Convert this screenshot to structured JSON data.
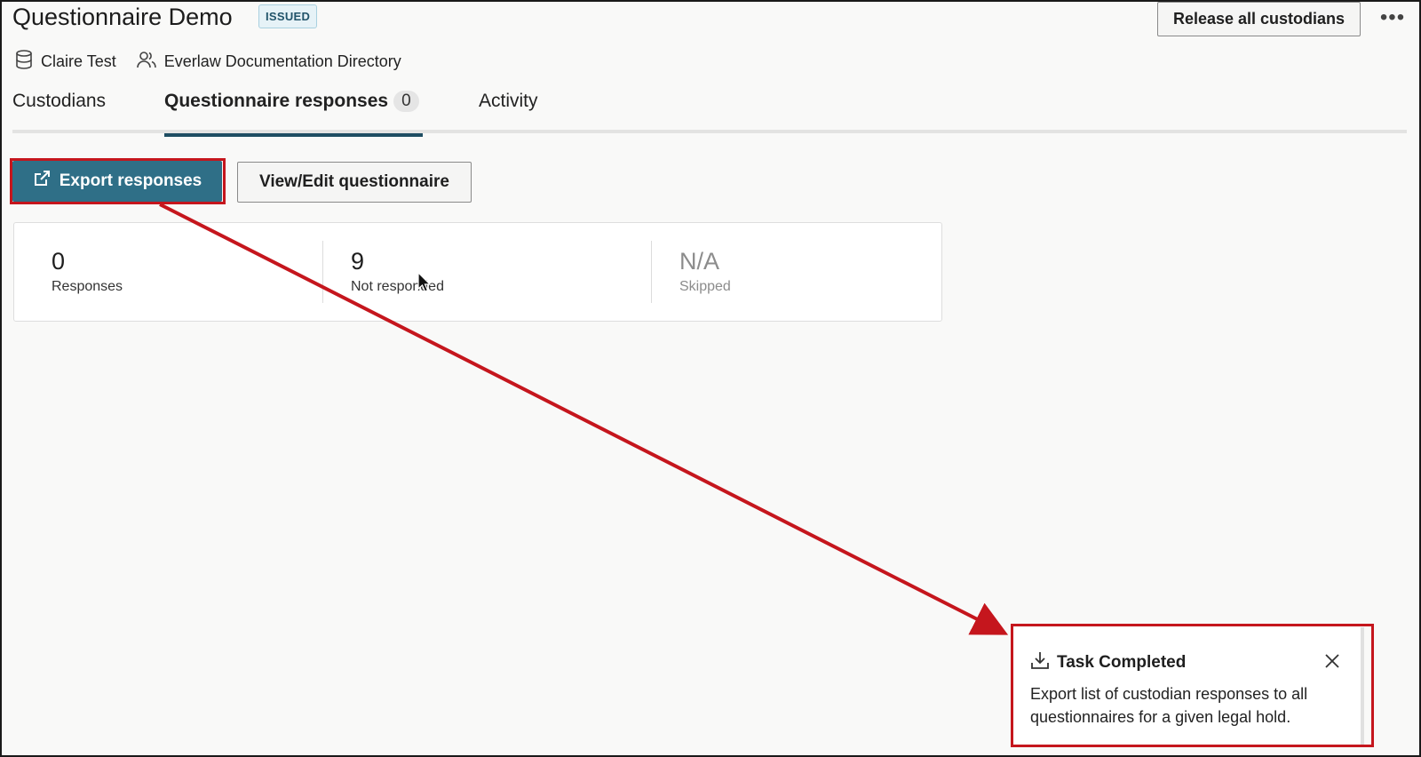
{
  "header": {
    "title": "Questionnaire Demo",
    "status_badge": "ISSUED",
    "release_button": "Release all custodians",
    "more_menu": "•••"
  },
  "meta": {
    "database": "Claire Test",
    "directory": "Everlaw Documentation Directory"
  },
  "tabs": [
    {
      "label": "Custodians",
      "active": false
    },
    {
      "label": "Questionnaire responses",
      "count": "0",
      "active": true
    },
    {
      "label": "Activity",
      "active": false
    }
  ],
  "actions": {
    "export_label": "Export responses",
    "view_edit_label": "View/Edit questionnaire"
  },
  "stats": [
    {
      "value": "0",
      "label": "Responses"
    },
    {
      "value": "9",
      "label": "Not responded"
    },
    {
      "value": "N/A",
      "label": "Skipped"
    }
  ],
  "toast": {
    "title": "Task Completed",
    "message": "Export list of custodian responses to all questionnaires for a given legal hold."
  },
  "colors": {
    "accent": "#2f6f87",
    "tab_indicator": "#1f4e63",
    "annotation": "#c5161d"
  },
  "icons": {
    "database": "database-icon",
    "directory": "users-icon",
    "export": "external-link-icon",
    "toast": "download-icon",
    "close": "close-icon"
  }
}
